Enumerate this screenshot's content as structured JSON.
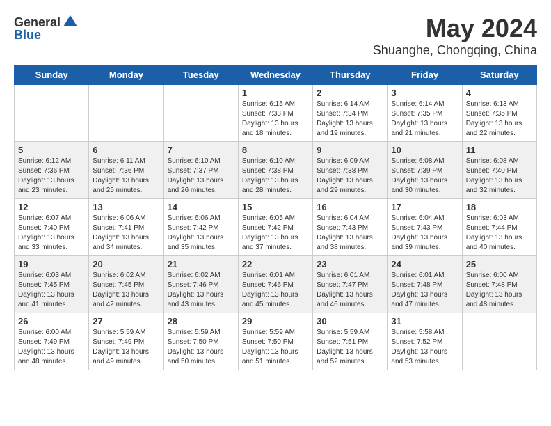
{
  "header": {
    "logo": {
      "general": "General",
      "blue": "Blue"
    },
    "title": "May 2024",
    "subtitle": "Shuanghe, Chongqing, China"
  },
  "columns": [
    "Sunday",
    "Monday",
    "Tuesday",
    "Wednesday",
    "Thursday",
    "Friday",
    "Saturday"
  ],
  "weeks": [
    [
      {
        "day": "",
        "info": ""
      },
      {
        "day": "",
        "info": ""
      },
      {
        "day": "",
        "info": ""
      },
      {
        "day": "1",
        "info": "Sunrise: 6:15 AM\nSunset: 7:33 PM\nDaylight: 13 hours\nand 18 minutes."
      },
      {
        "day": "2",
        "info": "Sunrise: 6:14 AM\nSunset: 7:34 PM\nDaylight: 13 hours\nand 19 minutes."
      },
      {
        "day": "3",
        "info": "Sunrise: 6:14 AM\nSunset: 7:35 PM\nDaylight: 13 hours\nand 21 minutes."
      },
      {
        "day": "4",
        "info": "Sunrise: 6:13 AM\nSunset: 7:35 PM\nDaylight: 13 hours\nand 22 minutes."
      }
    ],
    [
      {
        "day": "5",
        "info": "Sunrise: 6:12 AM\nSunset: 7:36 PM\nDaylight: 13 hours\nand 23 minutes."
      },
      {
        "day": "6",
        "info": "Sunrise: 6:11 AM\nSunset: 7:36 PM\nDaylight: 13 hours\nand 25 minutes."
      },
      {
        "day": "7",
        "info": "Sunrise: 6:10 AM\nSunset: 7:37 PM\nDaylight: 13 hours\nand 26 minutes."
      },
      {
        "day": "8",
        "info": "Sunrise: 6:10 AM\nSunset: 7:38 PM\nDaylight: 13 hours\nand 28 minutes."
      },
      {
        "day": "9",
        "info": "Sunrise: 6:09 AM\nSunset: 7:38 PM\nDaylight: 13 hours\nand 29 minutes."
      },
      {
        "day": "10",
        "info": "Sunrise: 6:08 AM\nSunset: 7:39 PM\nDaylight: 13 hours\nand 30 minutes."
      },
      {
        "day": "11",
        "info": "Sunrise: 6:08 AM\nSunset: 7:40 PM\nDaylight: 13 hours\nand 32 minutes."
      }
    ],
    [
      {
        "day": "12",
        "info": "Sunrise: 6:07 AM\nSunset: 7:40 PM\nDaylight: 13 hours\nand 33 minutes."
      },
      {
        "day": "13",
        "info": "Sunrise: 6:06 AM\nSunset: 7:41 PM\nDaylight: 13 hours\nand 34 minutes."
      },
      {
        "day": "14",
        "info": "Sunrise: 6:06 AM\nSunset: 7:42 PM\nDaylight: 13 hours\nand 35 minutes."
      },
      {
        "day": "15",
        "info": "Sunrise: 6:05 AM\nSunset: 7:42 PM\nDaylight: 13 hours\nand 37 minutes."
      },
      {
        "day": "16",
        "info": "Sunrise: 6:04 AM\nSunset: 7:43 PM\nDaylight: 13 hours\nand 38 minutes."
      },
      {
        "day": "17",
        "info": "Sunrise: 6:04 AM\nSunset: 7:43 PM\nDaylight: 13 hours\nand 39 minutes."
      },
      {
        "day": "18",
        "info": "Sunrise: 6:03 AM\nSunset: 7:44 PM\nDaylight: 13 hours\nand 40 minutes."
      }
    ],
    [
      {
        "day": "19",
        "info": "Sunrise: 6:03 AM\nSunset: 7:45 PM\nDaylight: 13 hours\nand 41 minutes."
      },
      {
        "day": "20",
        "info": "Sunrise: 6:02 AM\nSunset: 7:45 PM\nDaylight: 13 hours\nand 42 minutes."
      },
      {
        "day": "21",
        "info": "Sunrise: 6:02 AM\nSunset: 7:46 PM\nDaylight: 13 hours\nand 43 minutes."
      },
      {
        "day": "22",
        "info": "Sunrise: 6:01 AM\nSunset: 7:46 PM\nDaylight: 13 hours\nand 45 minutes."
      },
      {
        "day": "23",
        "info": "Sunrise: 6:01 AM\nSunset: 7:47 PM\nDaylight: 13 hours\nand 46 minutes."
      },
      {
        "day": "24",
        "info": "Sunrise: 6:01 AM\nSunset: 7:48 PM\nDaylight: 13 hours\nand 47 minutes."
      },
      {
        "day": "25",
        "info": "Sunrise: 6:00 AM\nSunset: 7:48 PM\nDaylight: 13 hours\nand 48 minutes."
      }
    ],
    [
      {
        "day": "26",
        "info": "Sunrise: 6:00 AM\nSunset: 7:49 PM\nDaylight: 13 hours\nand 48 minutes."
      },
      {
        "day": "27",
        "info": "Sunrise: 5:59 AM\nSunset: 7:49 PM\nDaylight: 13 hours\nand 49 minutes."
      },
      {
        "day": "28",
        "info": "Sunrise: 5:59 AM\nSunset: 7:50 PM\nDaylight: 13 hours\nand 50 minutes."
      },
      {
        "day": "29",
        "info": "Sunrise: 5:59 AM\nSunset: 7:50 PM\nDaylight: 13 hours\nand 51 minutes."
      },
      {
        "day": "30",
        "info": "Sunrise: 5:59 AM\nSunset: 7:51 PM\nDaylight: 13 hours\nand 52 minutes."
      },
      {
        "day": "31",
        "info": "Sunrise: 5:58 AM\nSunset: 7:52 PM\nDaylight: 13 hours\nand 53 minutes."
      },
      {
        "day": "",
        "info": ""
      }
    ]
  ]
}
